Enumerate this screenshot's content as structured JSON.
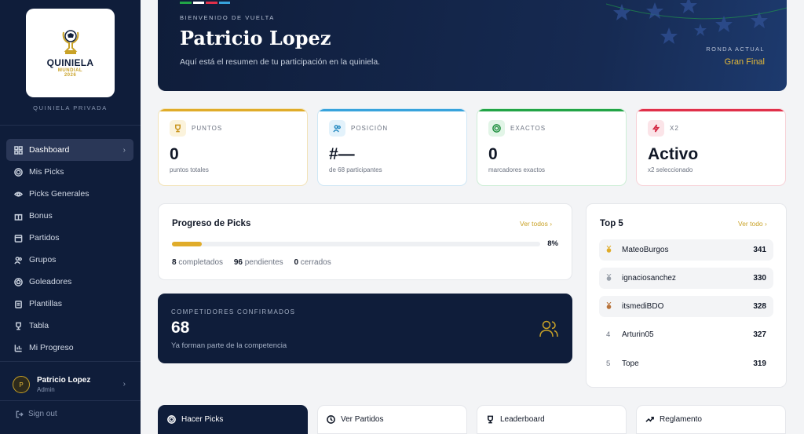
{
  "sidebar": {
    "logo": {
      "line1": "QUINIELA",
      "line2": "MUNDIAL",
      "line3": "2026"
    },
    "subtitle": "QUINIELA PRIVADA",
    "items": [
      {
        "label": "Dashboard",
        "icon": "dashboard-icon",
        "active": true
      },
      {
        "label": "Mis Picks",
        "icon": "target-icon"
      },
      {
        "label": "Picks Generales",
        "icon": "eye-icon"
      },
      {
        "label": "Bonus",
        "icon": "gift-icon"
      },
      {
        "label": "Partidos",
        "icon": "calendar-icon"
      },
      {
        "label": "Grupos",
        "icon": "users-icon"
      },
      {
        "label": "Goleadores",
        "icon": "ball-icon"
      },
      {
        "label": "Plantillas",
        "icon": "clipboard-icon"
      },
      {
        "label": "Tabla",
        "icon": "trophy-icon"
      },
      {
        "label": "Mi Progreso",
        "icon": "bar-chart-icon"
      }
    ],
    "user": {
      "initial": "P",
      "name": "Patricio Lopez",
      "role": "Admin"
    },
    "signout": "Sign out"
  },
  "banner": {
    "welcome": "BIENVENIDO DE VUELTA",
    "name": "Patricio Lopez",
    "summary": "Aquí está el resumen de tu participación en la quiniela.",
    "round_label": "RONDA ACTUAL",
    "round_value": "Gran Final"
  },
  "stats": [
    {
      "label": "PUNTOS",
      "value": "0",
      "sub": "puntos totales",
      "color": "#e0ac2a"
    },
    {
      "label": "POSICIÓN",
      "value": "#—",
      "sub": "de 68 participantes",
      "color": "#38a3dc"
    },
    {
      "label": "EXACTOS",
      "value": "0",
      "sub": "marcadores exactos",
      "color": "#22a447"
    },
    {
      "label": "X2",
      "value": "Activo",
      "sub": "x2 seleccionado",
      "color": "#e0304a"
    }
  ],
  "progress": {
    "title": "Progreso de Picks",
    "see_all": "Ver todos",
    "fraction": 0.08,
    "percent_label": "8%",
    "completed": "8",
    "completed_label": "completados",
    "pending": "96",
    "pending_label": "pendientes",
    "closed": "0",
    "closed_label": "cerrados"
  },
  "competitors": {
    "label": "COMPETIDORES CONFIRMADOS",
    "value": "68",
    "sub": "Ya forman parte de la competencia"
  },
  "top5": {
    "title": "Top 5",
    "see_all": "Ver todo",
    "rows": [
      {
        "rank": "1",
        "name": "MateoBurgos",
        "points": "341",
        "medal": "gold"
      },
      {
        "rank": "2",
        "name": "ignaciosanchez",
        "points": "330",
        "medal": "silver"
      },
      {
        "rank": "3",
        "name": "itsmediBDO",
        "points": "328",
        "medal": "bronze"
      },
      {
        "rank": "4",
        "name": "Arturin05",
        "points": "327"
      },
      {
        "rank": "5",
        "name": "Tope",
        "points": "319"
      }
    ]
  },
  "quick_actions": [
    {
      "label": "Hacer Picks",
      "icon": "target-icon"
    },
    {
      "label": "Ver Partidos",
      "icon": "clock-icon"
    },
    {
      "label": "Leaderboard",
      "icon": "trophy-icon"
    },
    {
      "label": "Reglamento",
      "icon": "trend-icon"
    }
  ]
}
